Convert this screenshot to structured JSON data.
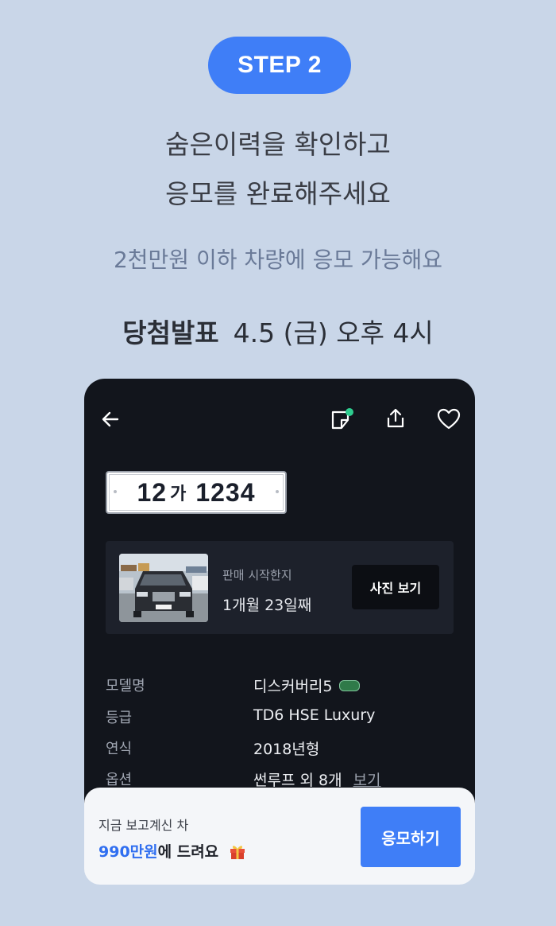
{
  "step_badge": "STEP 2",
  "headline": {
    "line1": "숨은이력을 확인하고",
    "line2": "응모를 완료해주세요"
  },
  "subtitle": "2천만원 이하 차량에 응모 가능해요",
  "announcement": {
    "label": "당첨발표",
    "value": "4.5 (금) 오후 4시"
  },
  "phone": {
    "icons": [
      "back-arrow-icon",
      "compare-icon",
      "share-icon",
      "heart-icon"
    ],
    "plate": {
      "digits1": "12",
      "hangul": "가",
      "digits2": "1234"
    },
    "sale_card": {
      "label": "판매 시작한지",
      "duration": "1개월 23일째",
      "photo_button": "사진 보기"
    },
    "specs": [
      {
        "key": "모델명",
        "value": "디스커버리5"
      },
      {
        "key": "등급",
        "value": "TD6 HSE Luxury"
      },
      {
        "key": "연식",
        "value": "2018년형"
      },
      {
        "key": "옵션",
        "value": "썬루프 외 8개",
        "link": "보기"
      }
    ]
  },
  "bottom_bar": {
    "line1": "지금 보고계신 차",
    "price": "990만원",
    "price_suffix": "에 드려요",
    "apply_button": "응모하기"
  },
  "colors": {
    "background": "#c9d6e8",
    "accent": "#3f7ef7",
    "phone_bg": "#12151c",
    "notification_dot": "#2ecc8f"
  }
}
